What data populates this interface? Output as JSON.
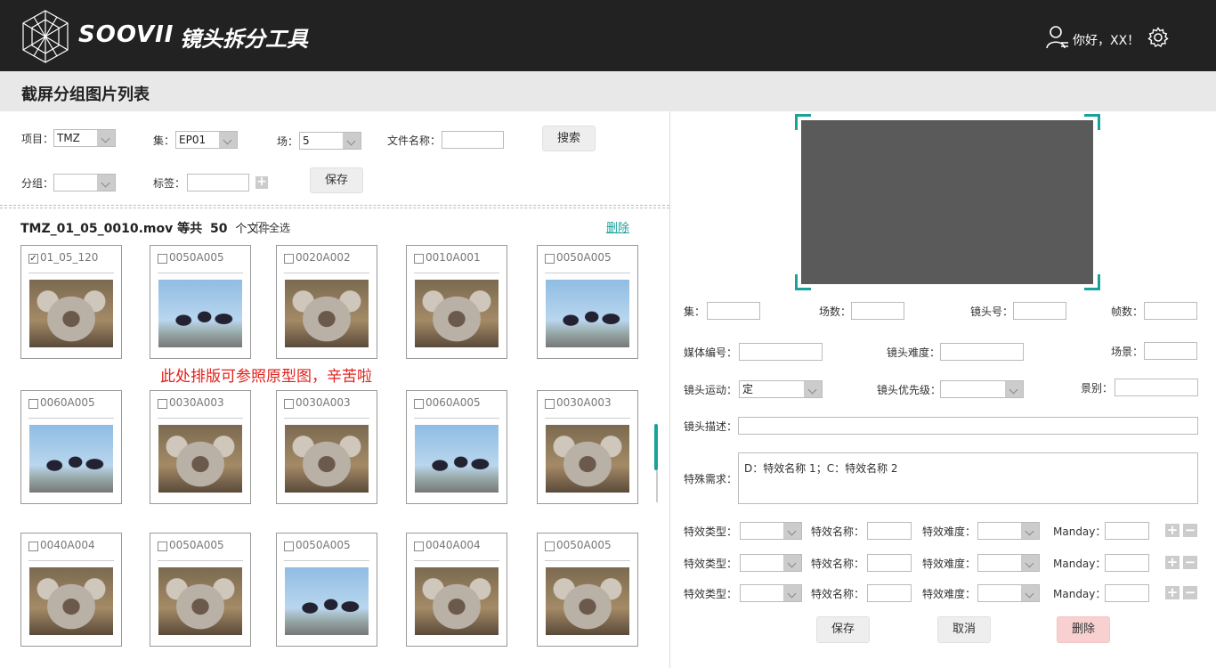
{
  "header": {
    "brand": "SOOVII",
    "tool_title": "镜头拆分工具",
    "greeting": "你好，XX！",
    "user_icon": "user-icon",
    "settings_icon": "gear-icon"
  },
  "page_title": "截屏分组图片列表",
  "filters": {
    "project_label": "项目：",
    "project_value": "TMZ",
    "episode_label": "集：",
    "episode_value": "EP01",
    "scene_label": "场：",
    "scene_value": "5",
    "filename_label": "文件名称：",
    "filename_value": "",
    "search_button": "搜索",
    "group_label": "分组：",
    "group_value": "",
    "tag_label": "标签：",
    "tag_value": "",
    "add_tag": "+",
    "save_button": "保存"
  },
  "files": {
    "name": "TMZ_01_05_0010.mov",
    "mid": "等共",
    "count": "50",
    "unit": "个文件",
    "select_all": "全选",
    "delete_link": "删除"
  },
  "cards": [
    {
      "name": "01_05_120",
      "img": "koala",
      "checked": true
    },
    {
      "name": "0050A005",
      "img": "penguin",
      "checked": false
    },
    {
      "name": "0020A002",
      "img": "koala",
      "checked": false
    },
    {
      "name": "0010A001",
      "img": "koala",
      "checked": false
    },
    {
      "name": "0050A005",
      "img": "penguin",
      "checked": false
    },
    {
      "name": "0060A005",
      "img": "penguin",
      "checked": false
    },
    {
      "name": "0030A003",
      "img": "koala",
      "checked": false
    },
    {
      "name": "0030A003",
      "img": "koala",
      "checked": false
    },
    {
      "name": "0060A005",
      "img": "penguin",
      "checked": false
    },
    {
      "name": "0030A003",
      "img": "koala",
      "checked": false
    },
    {
      "name": "0040A004",
      "img": "koala",
      "checked": false
    },
    {
      "name": "0050A005",
      "img": "koala",
      "checked": false
    },
    {
      "name": "0050A005",
      "img": "penguin",
      "checked": false
    },
    {
      "name": "0040A004",
      "img": "koala",
      "checked": false
    },
    {
      "name": "0050A005",
      "img": "koala",
      "checked": false
    }
  ],
  "note": "此处排版可参照原型图，辛苦啦",
  "detail": {
    "episode_label": "集：",
    "scene_count_label": "场数：",
    "shot_no_label": "镜头号：",
    "frames_label": "帧数：",
    "media_label": "媒体编号：",
    "difficulty_label": "镜头难度：",
    "setting_label": "场景：",
    "motion_label": "镜头运动：",
    "motion_value": "定",
    "priority_label": "镜头优先级：",
    "shot_size_label": "景别：",
    "desc_label": "镜头描述：",
    "special_label": "特殊需求：",
    "special_value": "D：特效名称 1；C：特效名称 2",
    "fx_rows": [
      {
        "type_label": "特效类型：",
        "name_label": "特效名称：",
        "diff_label": "特效难度：",
        "manday_label": "Manday："
      },
      {
        "type_label": "特效类型：",
        "name_label": "特效名称：",
        "diff_label": "特效难度：",
        "manday_label": "Manday："
      },
      {
        "type_label": "特效类型：",
        "name_label": "特效名称：",
        "diff_label": "特效难度：",
        "manday_label": "Manday："
      }
    ],
    "save_button": "保存",
    "cancel_button": "取消",
    "delete_button": "删除"
  },
  "colors": {
    "header_bg": "#222222",
    "accent": "#1aa19a",
    "note_red": "#e2211c",
    "delete_bg": "#f8d0d0"
  }
}
